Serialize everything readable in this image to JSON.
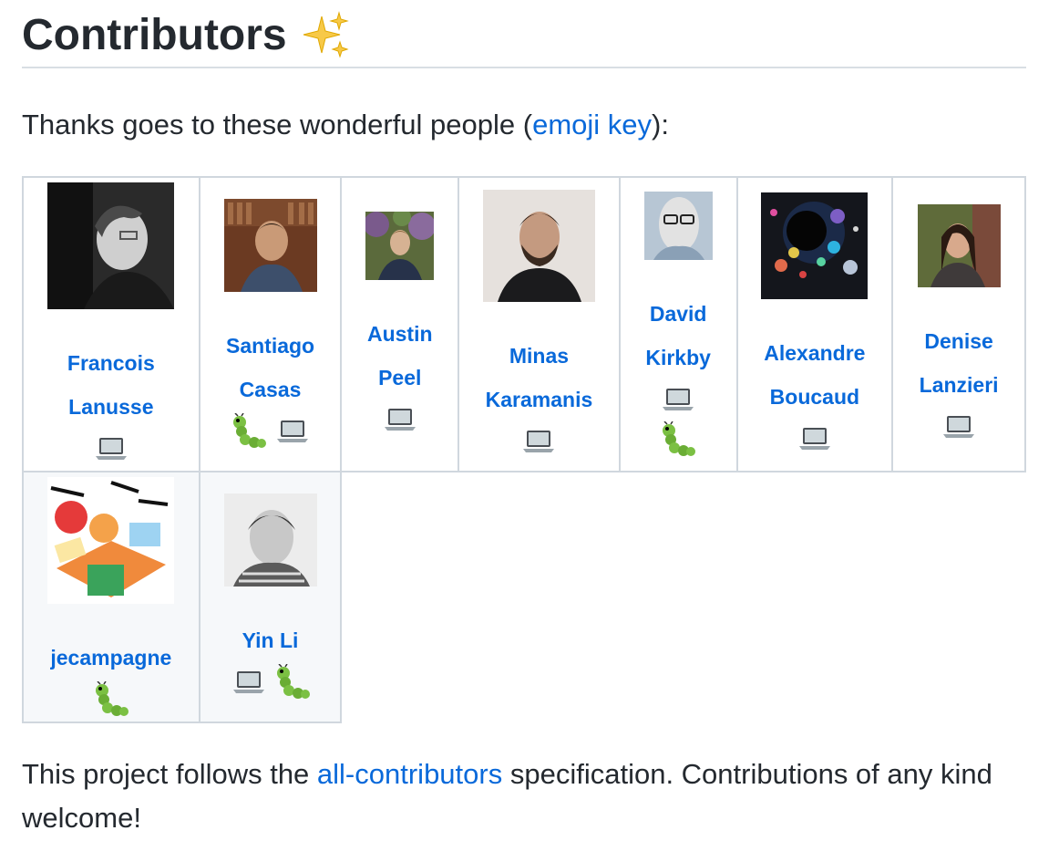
{
  "heading": {
    "title": "Contributors"
  },
  "intro": {
    "prefix": "Thanks goes to these wonderful people (",
    "link_text": "emoji key",
    "suffix": "):"
  },
  "contributors": [
    {
      "name_line1": "Francois",
      "name_line2": "Lanusse",
      "contributions": [
        "code"
      ]
    },
    {
      "name_line1": "Santiago",
      "name_line2": "Casas",
      "contributions": [
        "bug",
        "code"
      ]
    },
    {
      "name_line1": "Austin",
      "name_line2": "Peel",
      "contributions": [
        "code"
      ]
    },
    {
      "name_line1": "Minas",
      "name_line2": "Karamanis",
      "contributions": [
        "code"
      ]
    },
    {
      "name_line1": "David",
      "name_line2": "Kirkby",
      "contributions": [
        "code",
        "bug"
      ]
    },
    {
      "name_line1": "Alexandre",
      "name_line2": "Boucaud",
      "contributions": [
        "code"
      ]
    },
    {
      "name_line1": "Denise",
      "name_line2": "Lanzieri",
      "contributions": [
        "code"
      ]
    },
    {
      "name_line1": "jecampagne",
      "name_line2": "",
      "contributions": [
        "bug"
      ]
    },
    {
      "name_line1": "Yin Li",
      "name_line2": "",
      "contributions": [
        "code",
        "bug"
      ]
    }
  ],
  "footer": {
    "prefix": "This project follows the ",
    "link_text": "all-contributors",
    "suffix": " specification. Contributions of any kind welcome!"
  },
  "icons": {
    "heading": "sparkles-icon",
    "code": "laptop-icon",
    "bug": "caterpillar-icon"
  }
}
